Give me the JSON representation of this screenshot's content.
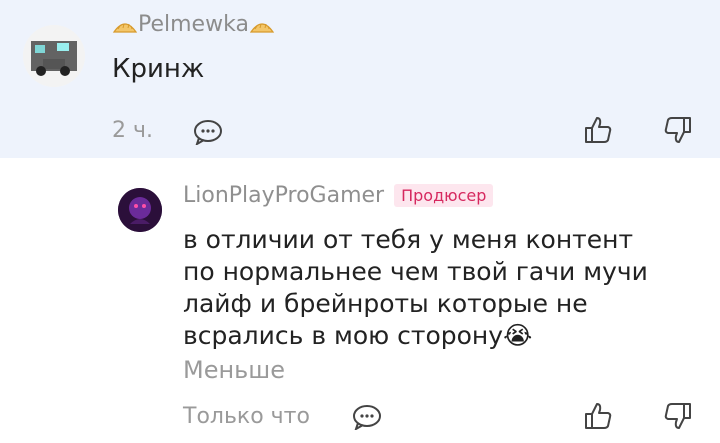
{
  "comments": [
    {
      "author": "Pelmewka",
      "text": "Кринж",
      "time": "2 ч."
    },
    {
      "author": "LionPlayProGamer",
      "badge": "Продюсер",
      "text": "в отличии от тебя у меня контент по нормальнее чем твой гачи мучи лайф и брейнроты которые не всрались в мою сторону",
      "emoji": "😭",
      "less_label": "Меньше",
      "time": "Только что"
    }
  ],
  "colors": {
    "highlight_bg": "#eef3fc",
    "badge_bg": "#fde6ee",
    "badge_text": "#d6285f"
  },
  "icons": [
    "dumpling-icon",
    "reply-icon",
    "like-icon",
    "dislike-icon",
    "crying-emoji"
  ]
}
